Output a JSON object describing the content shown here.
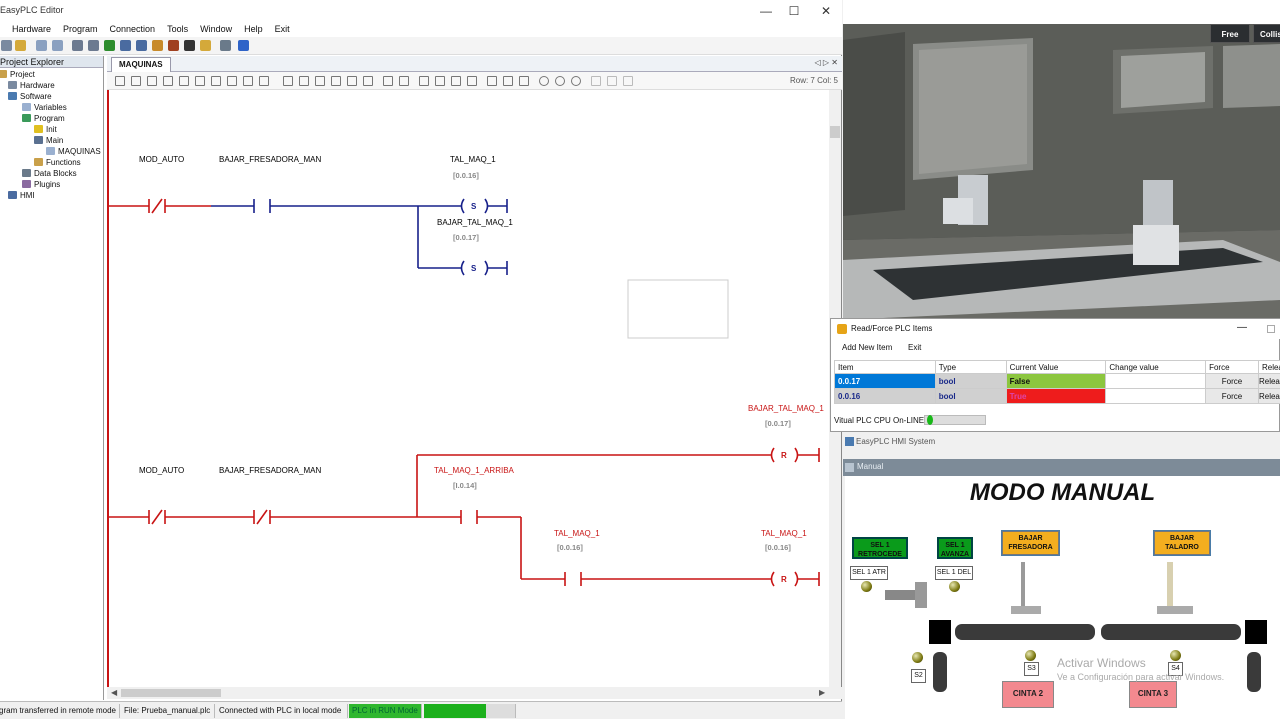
{
  "window": {
    "title": "EasyPLC Editor",
    "controls": [
      "—",
      "☐",
      "✕"
    ]
  },
  "menu": [
    "Hardware",
    "Program",
    "Connection",
    "Tools",
    "Window",
    "Help",
    "Exit"
  ],
  "explorer": {
    "header": "Project Explorer",
    "items": [
      "Project",
      "Hardware",
      "Software",
      "Variables",
      "Program",
      "Init",
      "Main",
      "MAQUINAS",
      "Functions",
      "Data Blocks",
      "Plugins",
      "HMI"
    ]
  },
  "editor": {
    "tab": "MAQUINAS",
    "tabnav": "◁ ▷ ✕",
    "rowcol": "Row: 7  Col: 5"
  },
  "ladder": {
    "rung1": {
      "contact1": "MOD_AUTO",
      "contact2": "BAJAR_FRESADORA_MAN",
      "coil1_name": "TAL_MAQ_1",
      "coil1_addr": "[0.0.16]",
      "coil1_type": "S",
      "coil2_name": "BAJAR_TAL_MAQ_1",
      "coil2_addr": "[0.0.17]",
      "coil2_type": "S"
    },
    "rung2": {
      "coil_top_name": "BAJAR_TAL_MAQ_1",
      "coil_top_addr": "[0.0.17]",
      "coil_top_type": "R",
      "contact1": "MOD_AUTO",
      "contact2": "BAJAR_FRESADORA_MAN",
      "contact3_name": "TAL_MAQ_1_ARRIBA",
      "contact3_addr": "[I.0.14]",
      "contact4_name": "TAL_MAQ_1",
      "contact4_addr": "[0.0.16]",
      "coil_bottom_name": "TAL_MAQ_1",
      "coil_bottom_addr": "[0.0.16]",
      "coil_bottom_type": "R"
    },
    "colors": {
      "energized": "#c81414",
      "off": "#17208a"
    }
  },
  "status": {
    "msg": "Program transferred in remote mode.",
    "file": "File: Prueba_manual.plc",
    "conn": "Connected with PLC in local mode",
    "run": "PLC in RUN Mode"
  },
  "scene": {
    "free": "Free",
    "collision": "Collisions"
  },
  "readforce": {
    "title": "Read/Force PLC Items",
    "menu": [
      "Add New Item",
      "Exit"
    ],
    "headers": [
      "Item",
      "Type",
      "Current Value",
      "Change value",
      "Force",
      "Release"
    ],
    "rows": [
      {
        "item": "0.0.17",
        "type": "bool",
        "value": "False",
        "force": "Force",
        "release": "Release"
      },
      {
        "item": "0.0.16",
        "type": "bool",
        "value": "True",
        "force": "Force",
        "release": "Release"
      }
    ],
    "status": "Vitual PLC CPU On-LINE"
  },
  "hmi": {
    "title": "EasyPLC HMI System",
    "tab": "Manual",
    "heading": "MODO MANUAL",
    "sel1_retro": "SEL 1 RETROCEDE",
    "sel1_avanza": "SEL 1 AVANZA",
    "bajar_fresadora": "BAJAR FRESADORA",
    "bajar_taladro": "BAJAR TALADRO",
    "sel1_atr": "SEL 1 ATR",
    "sel1_del": "SEL 1 DEL",
    "s2": "S2",
    "s3": "S3",
    "s4": "S4",
    "cinta2": "CINTA 2",
    "cinta3": "CINTA 3",
    "watermark1": "Activar Windows",
    "watermark2": "Ve a Configuración para activar Windows."
  }
}
